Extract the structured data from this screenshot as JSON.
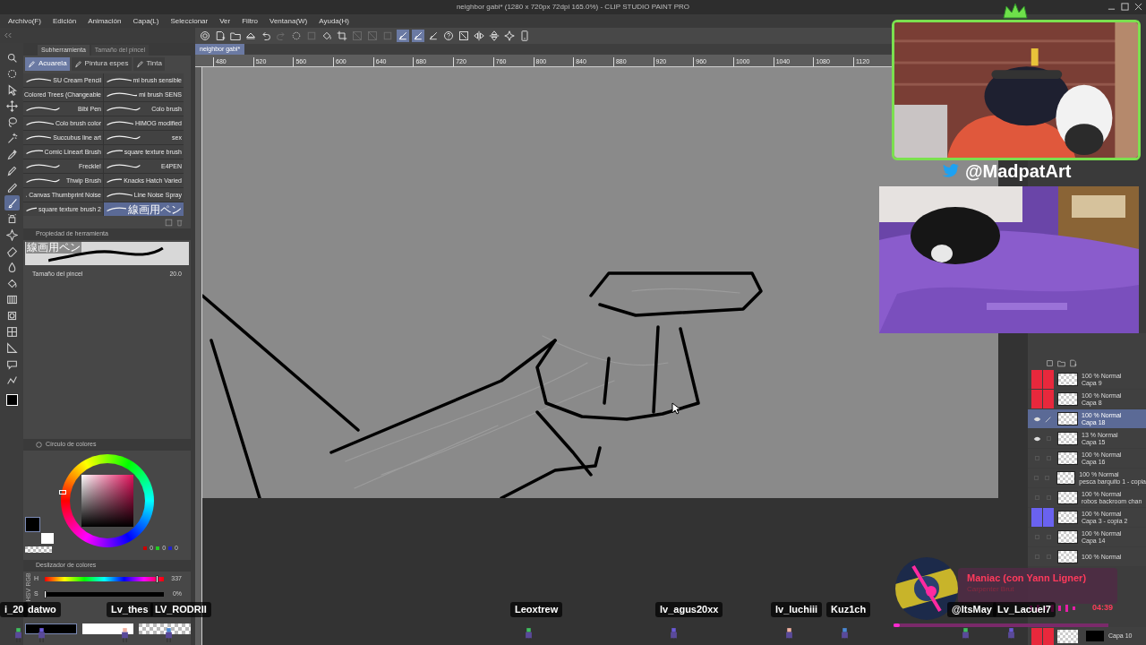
{
  "window": {
    "title": "neighbor gabi* (1280 x 720px 72dpi 165.0%) - CLIP STUDIO PAINT PRO"
  },
  "menu": [
    "Archivo(F)",
    "Edición",
    "Animación",
    "Capa(L)",
    "Seleccionar",
    "Ver",
    "Filtro",
    "Ventana(W)",
    "Ayuda(H)"
  ],
  "toolbar": [
    {
      "kind": "swirl",
      "selected": false,
      "disabled": false
    },
    {
      "kind": "newfile",
      "selected": false,
      "disabled": false
    },
    {
      "kind": "folder",
      "selected": false,
      "disabled": false
    },
    {
      "kind": "export",
      "selected": false,
      "disabled": false
    },
    {
      "kind": "undo",
      "selected": false,
      "disabled": false
    },
    {
      "kind": "redo",
      "selected": false,
      "disabled": true
    },
    {
      "kind": "spinner",
      "selected": false,
      "disabled": false
    },
    {
      "kind": "square",
      "selected": false,
      "disabled": true
    },
    {
      "kind": "bucket",
      "selected": false,
      "disabled": false
    },
    {
      "kind": "crop",
      "selected": false,
      "disabled": false
    },
    {
      "kind": "grid",
      "selected": false,
      "disabled": true
    },
    {
      "kind": "grid",
      "selected": false,
      "disabled": true
    },
    {
      "kind": "square",
      "selected": false,
      "disabled": true
    },
    {
      "kind": "snap",
      "selected": true,
      "disabled": false
    },
    {
      "kind": "snap",
      "selected": true,
      "disabled": false
    },
    {
      "kind": "snap",
      "selected": false,
      "disabled": false
    },
    {
      "kind": "help",
      "selected": false,
      "disabled": false
    },
    {
      "kind": "fit",
      "selected": false,
      "disabled": false
    },
    {
      "kind": "flip",
      "selected": false,
      "disabled": false
    },
    {
      "kind": "flipv",
      "selected": false,
      "disabled": false
    },
    {
      "kind": "sparkle",
      "selected": false,
      "disabled": false
    },
    {
      "kind": "phone",
      "selected": false,
      "disabled": false
    }
  ],
  "tools": [
    {
      "kind": "magnifier",
      "selected": false
    },
    {
      "kind": "rotate",
      "selected": false
    },
    {
      "kind": "pointer",
      "selected": false
    },
    {
      "kind": "move",
      "selected": false
    },
    {
      "kind": "lasso",
      "selected": false
    },
    {
      "kind": "wand",
      "selected": false
    },
    {
      "kind": "eyedropper",
      "selected": false
    },
    {
      "kind": "pen",
      "selected": false
    },
    {
      "kind": "pencil",
      "selected": false
    },
    {
      "kind": "brush",
      "selected": true
    },
    {
      "kind": "airbrush",
      "selected": false
    },
    {
      "kind": "sparkle",
      "selected": false
    },
    {
      "kind": "eraser",
      "selected": false
    },
    {
      "kind": "blend",
      "selected": false
    },
    {
      "kind": "bucket",
      "selected": false
    },
    {
      "kind": "gradient",
      "selected": false
    },
    {
      "kind": "shape",
      "selected": false
    },
    {
      "kind": "frame",
      "selected": false
    },
    {
      "kind": "ruler",
      "selected": false
    },
    {
      "kind": "balloon",
      "selected": false
    },
    {
      "kind": "line",
      "selected": false
    }
  ],
  "subtool_panel": {
    "tabs": [
      {
        "label": "Subherramienta",
        "selected": true
      },
      {
        "label": "Tamaño del pincel",
        "selected": false
      }
    ],
    "groups": [
      {
        "label": "Acuarela",
        "selected": true
      },
      {
        "label": "Pintura espes",
        "selected": false
      },
      {
        "label": "Tinta",
        "selected": false
      }
    ],
    "brushes": [
      {
        "name": "SU Cream Pencil",
        "selected": false
      },
      {
        "name": "mi brush sensible",
        "selected": false
      },
      {
        "name": "Colored Trees (Changeable",
        "selected": false
      },
      {
        "name": "mi brush SENS",
        "selected": false
      },
      {
        "name": "Bibi Pen",
        "selected": false
      },
      {
        "name": "Colo brush",
        "selected": false
      },
      {
        "name": "Colo brush color",
        "selected": false
      },
      {
        "name": "HIMOG modified",
        "selected": false
      },
      {
        "name": "Succubus line art",
        "selected": false
      },
      {
        "name": "sex",
        "selected": false
      },
      {
        "name": "Comic Lineart Brush",
        "selected": false
      },
      {
        "name": "square texture brush",
        "selected": false
      },
      {
        "name": "Freckle!",
        "selected": false
      },
      {
        "name": "E4PEN",
        "selected": false
      },
      {
        "name": "Thwip Brush",
        "selected": false
      },
      {
        "name": "Knacks Hatch Varied",
        "selected": false
      },
      {
        "name": "Canvas Thumbprint Noise",
        "selected": false
      },
      {
        "name": "Line Noise Spray",
        "selected": false
      },
      {
        "name": "square texture brush 2",
        "selected": false
      },
      {
        "name": "線画用ペン",
        "selected": true
      }
    ]
  },
  "tool_property": {
    "title": "Propiedad de herramienta",
    "preview_label": "線画用ペン",
    "size_label": "Tamaño del pincel",
    "size_value": "20.0"
  },
  "color_wheel": {
    "title": "Círculo de colores",
    "r": "0",
    "g": "0",
    "b": "0"
  },
  "color_slider": {
    "title": "Deslizador de colores",
    "modes": [
      "RGB",
      "HSV"
    ],
    "channels": [
      {
        "kind": "hue",
        "label": "H",
        "reading": "337",
        "level": 0.94
      },
      {
        "kind": "saturation",
        "label": "S",
        "reading": "0%",
        "level": 0
      }
    ]
  },
  "document_tab": {
    "label": "neighbor gabi*"
  },
  "ruler": [
    "480",
    "520",
    "560",
    "600",
    "640",
    "680",
    "720",
    "760",
    "800",
    "840",
    "880",
    "920",
    "960",
    "1000",
    "1040",
    "1080",
    "1120"
  ],
  "layers": [
    {
      "mode": "100 % Normal",
      "name": "Capa 9",
      "color": "#e8283c",
      "visible": false,
      "editing": false,
      "selected": false
    },
    {
      "mode": "100 % Normal",
      "name": "Capa 8",
      "color": "#e8283c",
      "visible": false,
      "editing": false,
      "selected": false
    },
    {
      "mode": "100 % Normal",
      "name": "Capa 18",
      "visible": true,
      "editing": true,
      "selected": true
    },
    {
      "mode": "13 % Normal",
      "name": "Capa 15",
      "visible": true,
      "editing": false,
      "selected": false
    },
    {
      "mode": "100 % Normal",
      "name": "Capa 16",
      "visible": false,
      "editing": false,
      "selected": false
    },
    {
      "mode": "100 % Normal",
      "name": "pesca barquito 1 - copia",
      "visible": false,
      "editing": false,
      "selected": false
    },
    {
      "mode": "100 % Normal",
      "name": "robos backroom chan",
      "visible": false,
      "editing": false,
      "selected": false
    },
    {
      "mode": "100 % Normal",
      "name": "Capa 3 - copia 2",
      "color": "#6a62f0",
      "visible": false,
      "editing": false,
      "selected": false
    },
    {
      "mode": "100 % Normal",
      "name": "Capa 14",
      "visible": false,
      "editing": false,
      "selected": false
    },
    {
      "mode": "100 % Normal",
      "visible": false,
      "editing": false,
      "selected": false
    }
  ],
  "last_layer": {
    "name": "Capa 10",
    "color": "#e8283c"
  },
  "stream": {
    "handle": "@MadpatArt",
    "music": {
      "title": "Maniac (con Yann Ligner)",
      "artist": "Carpenter Brut",
      "time": "04:39",
      "level": 0.03
    },
    "chat": [
      {
        "name": "i_20"
      },
      {
        "name": "datwo"
      },
      {
        "name": "Lv_thes"
      },
      {
        "name": "LV_RODRII"
      },
      {
        "name": "Leoxtrew"
      },
      {
        "name": "lv_agus20xx"
      },
      {
        "name": "lv_luchiii"
      },
      {
        "name": "Kuz1ch"
      },
      {
        "name": "@ItsMay"
      },
      {
        "name": "Lv_Lacuel7"
      }
    ]
  }
}
